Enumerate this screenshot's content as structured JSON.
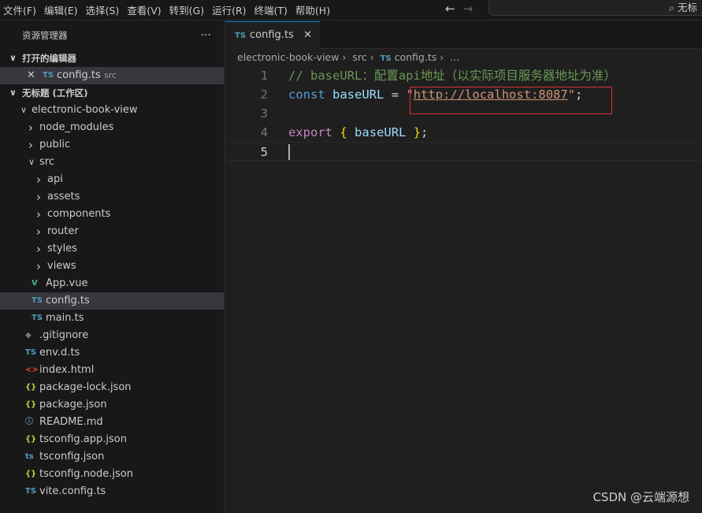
{
  "menu": [
    "文件(F)",
    "编辑(E)",
    "选择(S)",
    "查看(V)",
    "转到(G)",
    "运行(R)",
    "终端(T)",
    "帮助(H)"
  ],
  "nav": {
    "back": "←",
    "forward": "→"
  },
  "search": {
    "text": "无标"
  },
  "sidebar": {
    "title": "资源管理器",
    "more": "···",
    "open_editors": {
      "label": "打开的编辑器",
      "file": "config.ts",
      "dir": "src"
    },
    "workspace": "无标题 (工作区)",
    "tree": [
      {
        "label": "electronic-book-view",
        "type": "folder-open",
        "depth": 0
      },
      {
        "label": "node_modules",
        "type": "folder",
        "depth": 1
      },
      {
        "label": "public",
        "type": "folder",
        "depth": 1
      },
      {
        "label": "src",
        "type": "folder-open",
        "depth": 1
      },
      {
        "label": "api",
        "type": "folder",
        "depth": 2
      },
      {
        "label": "assets",
        "type": "folder",
        "depth": 2
      },
      {
        "label": "components",
        "type": "folder",
        "depth": 2
      },
      {
        "label": "router",
        "type": "folder",
        "depth": 2
      },
      {
        "label": "styles",
        "type": "folder",
        "depth": 2
      },
      {
        "label": "views",
        "type": "folder",
        "depth": 2
      },
      {
        "label": "App.vue",
        "type": "vue",
        "depth": 2
      },
      {
        "label": "config.ts",
        "type": "ts",
        "depth": 2,
        "selected": true
      },
      {
        "label": "main.ts",
        "type": "ts",
        "depth": 2
      },
      {
        "label": ".gitignore",
        "type": "git",
        "depth": 1
      },
      {
        "label": "env.d.ts",
        "type": "ts",
        "depth": 1
      },
      {
        "label": "index.html",
        "type": "html",
        "depth": 1
      },
      {
        "label": "package-lock.json",
        "type": "json",
        "depth": 1
      },
      {
        "label": "package.json",
        "type": "json",
        "depth": 1
      },
      {
        "label": "README.md",
        "type": "info",
        "depth": 1
      },
      {
        "label": "tsconfig.app.json",
        "type": "json",
        "depth": 1
      },
      {
        "label": "tsconfig.json",
        "type": "tsconfig",
        "depth": 1
      },
      {
        "label": "tsconfig.node.json",
        "type": "json",
        "depth": 1
      },
      {
        "label": "vite.config.ts",
        "type": "ts",
        "depth": 1
      }
    ]
  },
  "tab": {
    "label": "config.ts",
    "close": "✕"
  },
  "breadcrumb": [
    "electronic-book-view",
    "src",
    "config.ts",
    "..."
  ],
  "code": {
    "line1": "// baseURL：配置api地址（以实际项目服务器地址为准）",
    "line2": {
      "kw": "const",
      "name": "baseURL",
      "eq": "=",
      "q1": "\"",
      "url": "http://localhost:8087",
      "q2": "\"",
      "semi": ";"
    },
    "line4": {
      "kw": "export",
      "open": "{",
      "name": "baseURL",
      "close": "}",
      "semi": ";"
    },
    "line_numbers": [
      "1",
      "2",
      "3",
      "4",
      "5"
    ]
  },
  "watermark": "CSDN @云端源想"
}
